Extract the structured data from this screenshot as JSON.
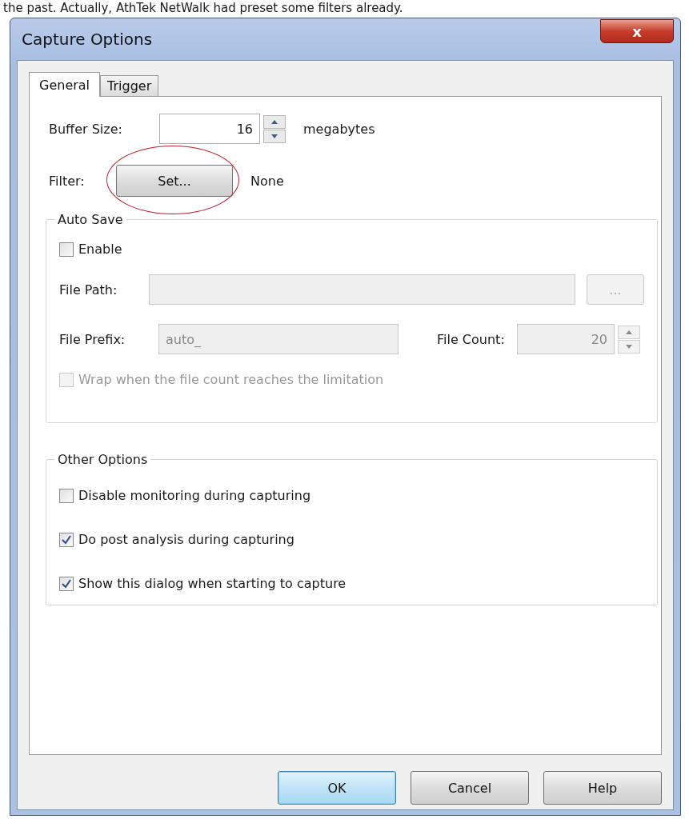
{
  "caption_text": "the past. Actually, AthTek NetWalk had preset some filters already.",
  "window": {
    "title": "Capture Options",
    "close": "x"
  },
  "tabs": [
    {
      "label": "General",
      "selected": true
    },
    {
      "label": "Trigger",
      "selected": false
    }
  ],
  "buffer": {
    "label": "Buffer Size:",
    "value": "16",
    "unit": "megabytes"
  },
  "filter": {
    "label": "Filter:",
    "button": "Set...",
    "value": "None",
    "highlighted": true
  },
  "auto_save": {
    "title": "Auto Save",
    "enable": {
      "label": "Enable",
      "checked": false,
      "disabled": false
    },
    "file_path": {
      "label": "File Path:",
      "browse": "...",
      "disabled": true
    },
    "file_prefix": {
      "label": "File Prefix:",
      "value": "auto_",
      "disabled": true
    },
    "file_count": {
      "label": "File Count:",
      "value": "20",
      "disabled": true
    },
    "wrap": {
      "label": "Wrap when the file count reaches the limitation",
      "checked": false,
      "disabled": true
    }
  },
  "other_options": {
    "title": "Other Options",
    "items": [
      {
        "label": "Disable monitoring during capturing",
        "checked": false,
        "disabled": false
      },
      {
        "label": "Do post analysis during capturing",
        "checked": true,
        "disabled": false
      },
      {
        "label": "Show this dialog when starting to capture",
        "checked": true,
        "disabled": false
      }
    ]
  },
  "buttons": [
    {
      "label": "OK",
      "default": true
    },
    {
      "label": "Cancel",
      "default": false
    },
    {
      "label": "Help",
      "default": false
    }
  ]
}
